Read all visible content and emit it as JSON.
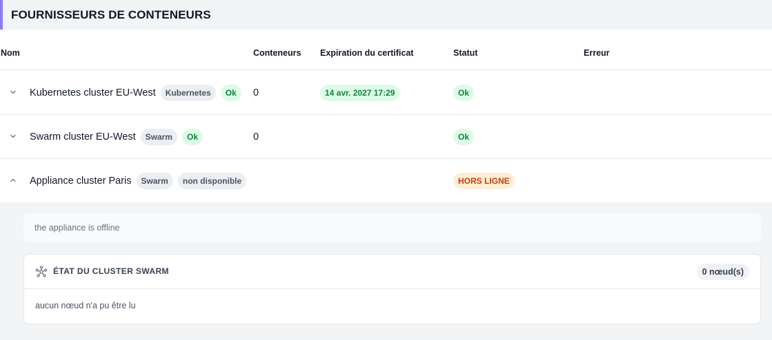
{
  "header": {
    "title": "FOURNISSEURS DE CONTENEURS",
    "accent_color": "#8b7cf6"
  },
  "table": {
    "columns": [
      "Nom",
      "Conteneurs",
      "Expiration du certificat",
      "Statut",
      "Erreur"
    ],
    "rows": [
      {
        "chevron": "chevron-down-icon",
        "name": "Kubernetes cluster EU-West",
        "type_badge": "Kubernetes",
        "state_badge": "Ok",
        "containers": "0",
        "cert_expiration": "14 avr. 2027 17:29",
        "status": "Ok",
        "error": ""
      },
      {
        "chevron": "chevron-down-icon",
        "name": "Swarm cluster EU-West",
        "type_badge": "Swarm",
        "state_badge": "Ok",
        "containers": "0",
        "cert_expiration": "",
        "status": "Ok",
        "error": ""
      },
      {
        "chevron": "chevron-up-icon",
        "name": "Appliance cluster Paris",
        "type_badge": "Swarm",
        "state_badge": "non disponible",
        "containers": "",
        "cert_expiration": "",
        "status": "HORS LIGNE",
        "error": ""
      }
    ]
  },
  "expanded": {
    "message": "the appliance is offline",
    "card": {
      "icon": "cluster-icon",
      "title": "ÉTAT DU CLUSTER SWARM",
      "node_count": "0 nœud(s)",
      "body": "aucun nœud n'a pu être lu"
    }
  },
  "colors": {
    "ok_bg": "#dcfce7",
    "ok_text": "#15803d",
    "offline_bg": "#ffedd5",
    "offline_text": "#c2410c",
    "neutral_bg": "#eceef2",
    "neutral_text": "#4b5563"
  }
}
